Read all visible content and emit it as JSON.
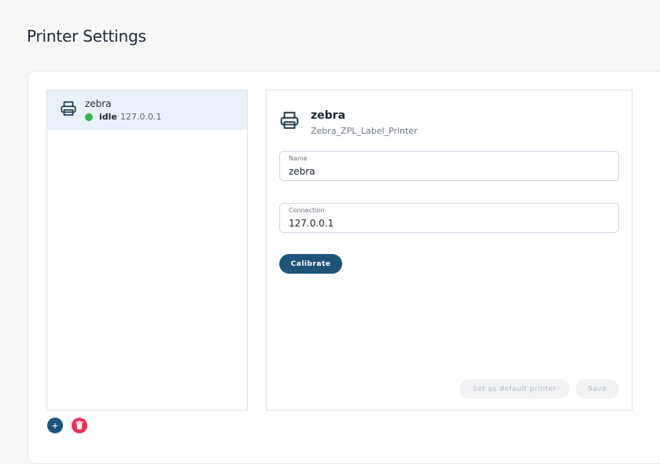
{
  "page": {
    "title": "Printer Settings"
  },
  "printer_list": [
    {
      "name": "zebra",
      "status": "idle",
      "ip": "127.0.0.1",
      "status_color": "#3cb44b"
    }
  ],
  "detail": {
    "name": "zebra",
    "model": "Zebra_ZPL_Label_Printer",
    "fields": {
      "name": {
        "label": "Name",
        "value": "zebra"
      },
      "connection": {
        "label": "Connection",
        "value": "127.0.0.1"
      }
    },
    "calibrate_label": "Calibrate",
    "set_default_label": "Set as default printer",
    "save_label": "Save"
  },
  "actions": {
    "add_symbol": "+"
  },
  "colors": {
    "primary": "#1f5479",
    "danger": "#f0315a",
    "selected_bg": "#e9f1fb"
  }
}
